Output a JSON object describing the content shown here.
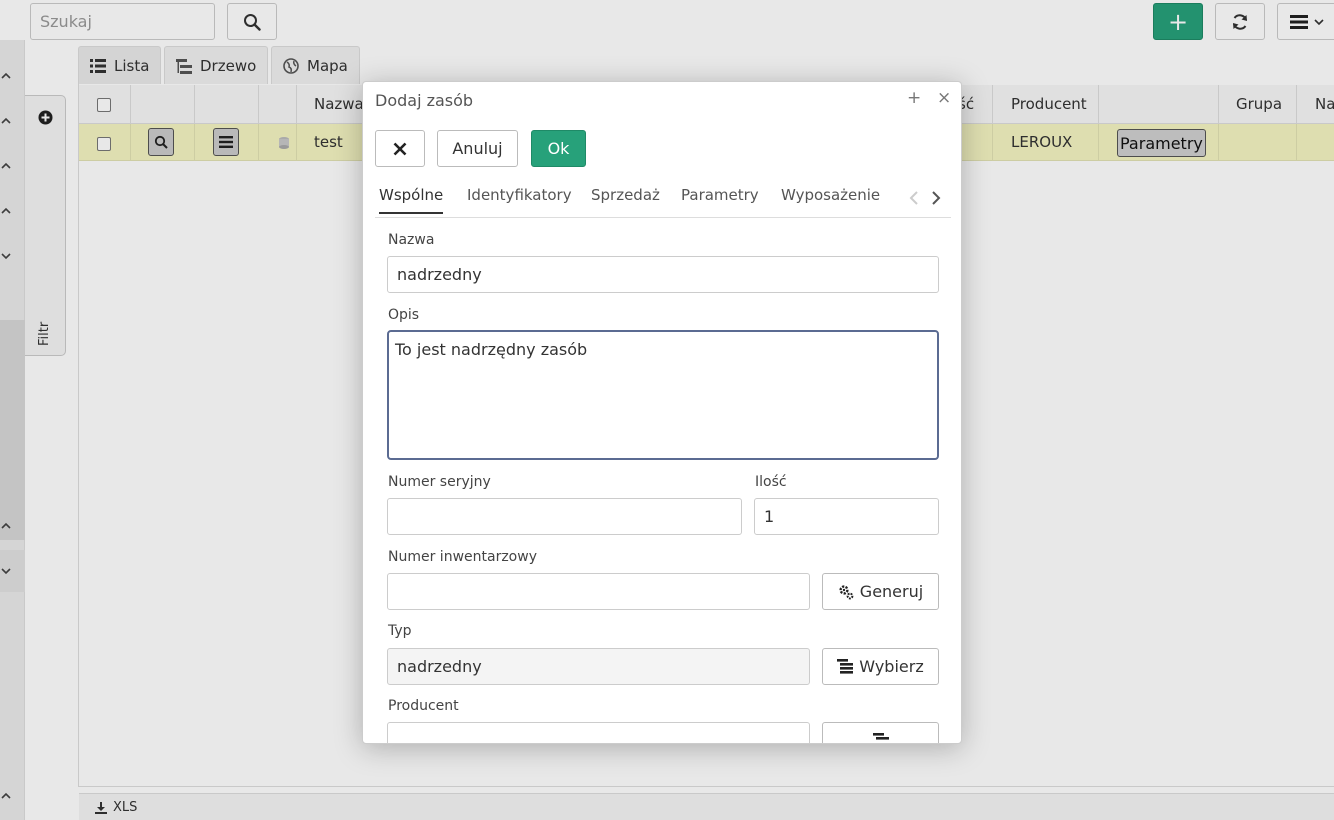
{
  "toolbar": {
    "search_placeholder": "Szukaj",
    "add_label": "+"
  },
  "view_tabs": [
    {
      "label": "Lista"
    },
    {
      "label": "Drzewo"
    },
    {
      "label": "Mapa"
    }
  ],
  "filter": {
    "label": "Filtr"
  },
  "grid": {
    "headers": {
      "nazwa": "Nazwa",
      "ilosc_partial": "ść",
      "producent": "Producent",
      "grupa": "Grupa",
      "na_partial": "Na"
    },
    "row": {
      "nazwa": "test",
      "producent": "LEROUX",
      "parametry_label": "Parametry"
    }
  },
  "footer": {
    "export_label": "XLS"
  },
  "dialog": {
    "title": "Dodaj zasób",
    "cancel_label": "Anuluj",
    "ok_label": "Ok",
    "tabs": [
      "Wspólne",
      "Identyfikatory",
      "Sprzedaż",
      "Parametry",
      "Wyposażenie"
    ],
    "fields": {
      "nazwa": {
        "label": "Nazwa",
        "value": "nadrzedny"
      },
      "opis": {
        "label": "Opis",
        "value": "To jest nadrzędny zasób"
      },
      "numer_seryjny": {
        "label": "Numer seryjny",
        "value": ""
      },
      "ilosc": {
        "label": "Ilość",
        "value": "1"
      },
      "numer_inwentarzowy": {
        "label": "Numer inwentarzowy",
        "value": ""
      },
      "generuj_label": "Generuj",
      "typ": {
        "label": "Typ",
        "value": "nadrzedny"
      },
      "wybierz_label": "Wybierz",
      "producent": {
        "label": "Producent",
        "value": ""
      }
    }
  },
  "colors": {
    "accent_green": "#27a17a",
    "row_highlight": "#f4f4c2",
    "textarea_focus": "#5b6b92"
  }
}
